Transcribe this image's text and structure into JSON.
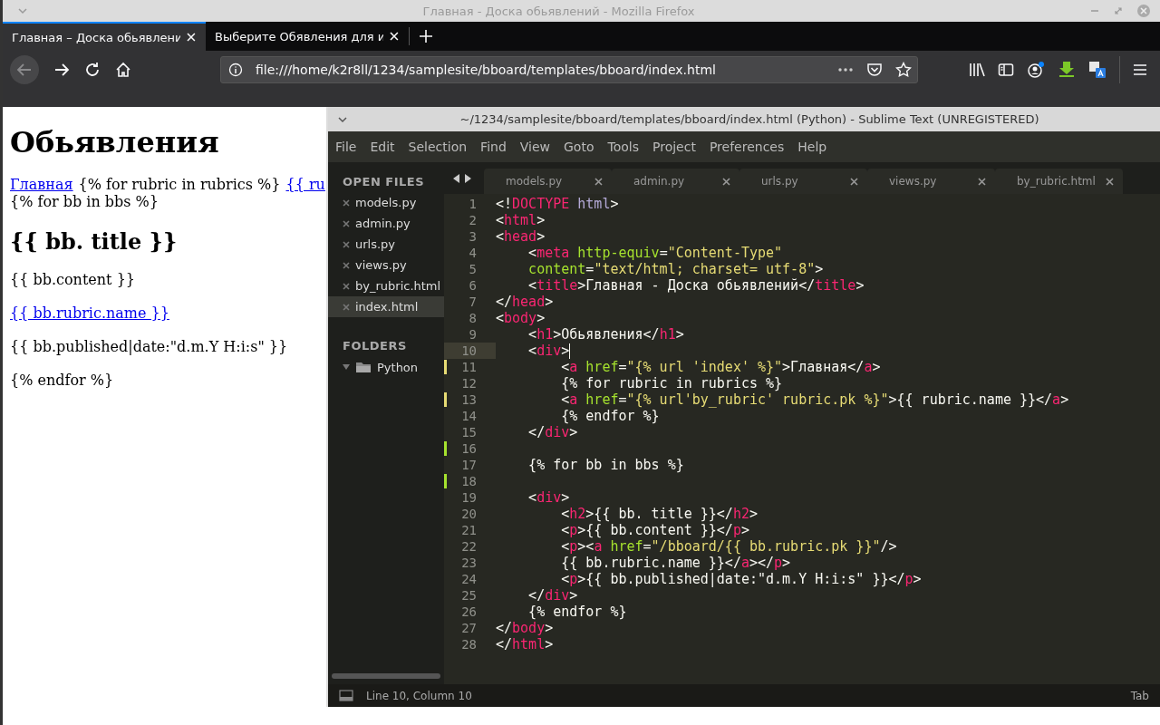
{
  "browser": {
    "title": "Главная - Доска обьявлений - Mozilla Firefox",
    "tabs": [
      {
        "label": "Главная – Доска обьявлени",
        "selected": true
      },
      {
        "label": "Выберите Обявления для и",
        "selected": false
      }
    ],
    "url": "file:///home/k2r8ll/1234/samplesite/bboard/templates/bboard/index.html",
    "page": {
      "heading": "Обьявления",
      "nav": [
        {
          "kind": "link",
          "text": "Главная"
        },
        {
          "kind": "text",
          "text": "{% for rubric in rubrics %}"
        },
        {
          "kind": "link",
          "text": "{{ ru"
        }
      ],
      "loop": "{% for bb in bbs %}",
      "title": "{{ bb. title }}",
      "blocks": [
        {
          "kind": "text",
          "text": "{{ bb.content }}"
        },
        {
          "kind": "link",
          "text": "{{ bb.rubric.name }}"
        },
        {
          "kind": "text",
          "text": "{{ bb.published|date:\"d.m.Y H:i:s\" }}"
        },
        {
          "kind": "text",
          "text": "{% endfor %}"
        }
      ]
    }
  },
  "editor": {
    "title": "~/1234/samplesite/bboard/templates/bboard/index.html (Python) - Sublime Text (UNREGISTERED)",
    "menu": [
      "File",
      "Edit",
      "Selection",
      "Find",
      "View",
      "Goto",
      "Tools",
      "Project",
      "Preferences",
      "Help"
    ],
    "open_files": {
      "heading": "OPEN FILES",
      "items": [
        {
          "name": "models.py",
          "selected": false
        },
        {
          "name": "admin.py",
          "selected": false
        },
        {
          "name": "urls.py",
          "selected": false
        },
        {
          "name": "views.py",
          "selected": false
        },
        {
          "name": "by_rubric.html",
          "selected": false
        },
        {
          "name": "index.html",
          "selected": true
        }
      ]
    },
    "folders": {
      "heading": "FOLDERS",
      "items": [
        {
          "name": "Python",
          "expanded": true
        }
      ]
    },
    "tabs": [
      {
        "label": "models.py",
        "selected": false
      },
      {
        "label": "admin.py",
        "selected": false
      },
      {
        "label": "urls.py",
        "selected": false
      },
      {
        "label": "views.py",
        "selected": false
      },
      {
        "label": "by_rubric.html",
        "selected": false
      }
    ],
    "lines": [
      {
        "number": "1",
        "current": false,
        "tokens": [
          {
            "kind": "p",
            "text": "<!"
          },
          {
            "kind": "tag",
            "text": "DOCTYPE"
          },
          {
            "kind": "kw",
            "text": " html"
          },
          {
            "kind": "p",
            "text": ">"
          }
        ]
      },
      {
        "number": "2",
        "current": false,
        "tokens": [
          {
            "kind": "p",
            "text": "<"
          },
          {
            "kind": "tag",
            "text": "html"
          },
          {
            "kind": "p",
            "text": ">"
          }
        ]
      },
      {
        "number": "3",
        "current": false,
        "tokens": [
          {
            "kind": "p",
            "text": "<"
          },
          {
            "kind": "tag",
            "text": "head"
          },
          {
            "kind": "p",
            "text": ">"
          }
        ]
      },
      {
        "number": "4",
        "current": false,
        "tokens": [
          {
            "kind": "p",
            "text": "    <"
          },
          {
            "kind": "tag",
            "text": "meta"
          },
          {
            "kind": "attr",
            "text": " http-equiv"
          },
          {
            "kind": "p",
            "text": "="
          },
          {
            "kind": "str",
            "text": "\"Content-Type\""
          }
        ]
      },
      {
        "number": "5",
        "current": false,
        "tokens": [
          {
            "kind": "attr",
            "text": "    content"
          },
          {
            "kind": "p",
            "text": "="
          },
          {
            "kind": "str",
            "text": "\"text/html; charset= utf-8\""
          },
          {
            "kind": "p",
            "text": ">"
          }
        ]
      },
      {
        "number": "6",
        "current": false,
        "tokens": [
          {
            "kind": "p",
            "text": "    <"
          },
          {
            "kind": "tag",
            "text": "title"
          },
          {
            "kind": "p",
            "text": ">Главная - Доска обьявлений</"
          },
          {
            "kind": "tag",
            "text": "title"
          },
          {
            "kind": "p",
            "text": ">"
          }
        ]
      },
      {
        "number": "7",
        "current": false,
        "tokens": [
          {
            "kind": "p",
            "text": "</"
          },
          {
            "kind": "tag",
            "text": "head"
          },
          {
            "kind": "p",
            "text": ">"
          }
        ]
      },
      {
        "number": "8",
        "current": false,
        "tokens": [
          {
            "kind": "p",
            "text": "<"
          },
          {
            "kind": "tag",
            "text": "body"
          },
          {
            "kind": "p",
            "text": ">"
          }
        ]
      },
      {
        "number": "9",
        "current": false,
        "tokens": [
          {
            "kind": "p",
            "text": "    <"
          },
          {
            "kind": "tag",
            "text": "h1"
          },
          {
            "kind": "p",
            "text": ">Обьявления</"
          },
          {
            "kind": "tag",
            "text": "h1"
          },
          {
            "kind": "p",
            "text": ">"
          }
        ]
      },
      {
        "number": "10",
        "current": true,
        "tokens": [
          {
            "kind": "p",
            "text": "    <"
          },
          {
            "kind": "tag",
            "text": "div"
          },
          {
            "kind": "p",
            "text": ">"
          }
        ]
      },
      {
        "number": "11",
        "current": false,
        "color": "#e6db74",
        "tokens": [
          {
            "kind": "p",
            "text": "        <"
          },
          {
            "kind": "tag",
            "text": "a"
          },
          {
            "kind": "attr",
            "text": " href"
          },
          {
            "kind": "p",
            "text": "="
          },
          {
            "kind": "str",
            "text": "\"{% url 'index' %}\""
          },
          {
            "kind": "p",
            "text": ">Главная</"
          },
          {
            "kind": "tag",
            "text": "a"
          },
          {
            "kind": "p",
            "text": ">"
          }
        ]
      },
      {
        "number": "12",
        "current": false,
        "tokens": [
          {
            "kind": "p",
            "text": "        {% for rubric in rubrics %}"
          }
        ]
      },
      {
        "number": "13",
        "current": false,
        "color": "#e6db74",
        "tokens": [
          {
            "kind": "p",
            "text": "        <"
          },
          {
            "kind": "tag",
            "text": "a"
          },
          {
            "kind": "attr",
            "text": " href"
          },
          {
            "kind": "p",
            "text": "="
          },
          {
            "kind": "str",
            "text": "\"{% url'by_rubric' rubric.pk %}\""
          },
          {
            "kind": "p",
            "text": ">{{ rubric.name }}</"
          },
          {
            "kind": "tag",
            "text": "a"
          },
          {
            "kind": "p",
            "text": ">"
          }
        ]
      },
      {
        "number": "14",
        "current": false,
        "tokens": [
          {
            "kind": "p",
            "text": "        {% endfor %}"
          }
        ]
      },
      {
        "number": "15",
        "current": false,
        "tokens": [
          {
            "kind": "p",
            "text": "    </"
          },
          {
            "kind": "tag",
            "text": "div"
          },
          {
            "kind": "p",
            "text": ">"
          }
        ]
      },
      {
        "number": "16",
        "current": false,
        "color": "#a6e22e"
      },
      {
        "number": "17",
        "current": false,
        "tokens": [
          {
            "kind": "p",
            "text": "    {% for bb in bbs %}"
          }
        ]
      },
      {
        "number": "18",
        "current": false,
        "color": "#a6e22e"
      },
      {
        "number": "19",
        "current": false,
        "tokens": [
          {
            "kind": "p",
            "text": "    <"
          },
          {
            "kind": "tag",
            "text": "div"
          },
          {
            "kind": "p",
            "text": ">"
          }
        ]
      },
      {
        "number": "20",
        "current": false,
        "tokens": [
          {
            "kind": "p",
            "text": "        <"
          },
          {
            "kind": "tag",
            "text": "h2"
          },
          {
            "kind": "p",
            "text": ">{{ bb. title }}</"
          },
          {
            "kind": "tag",
            "text": "h2"
          },
          {
            "kind": "p",
            "text": ">"
          }
        ]
      },
      {
        "number": "21",
        "current": false,
        "tokens": [
          {
            "kind": "p",
            "text": "        <"
          },
          {
            "kind": "tag",
            "text": "p"
          },
          {
            "kind": "p",
            "text": ">{{ bb.content }}</"
          },
          {
            "kind": "tag",
            "text": "p"
          },
          {
            "kind": "p",
            "text": ">"
          }
        ]
      },
      {
        "number": "22",
        "current": false,
        "tokens": [
          {
            "kind": "p",
            "text": "        <"
          },
          {
            "kind": "tag",
            "text": "p"
          },
          {
            "kind": "p",
            "text": "><"
          },
          {
            "kind": "tag",
            "text": "a"
          },
          {
            "kind": "attr",
            "text": " href"
          },
          {
            "kind": "p",
            "text": "="
          },
          {
            "kind": "str",
            "text": "\"/bboard/{{ bb.rubric.pk }}\""
          },
          {
            "kind": "p",
            "text": "/>"
          }
        ]
      },
      {
        "number": "23",
        "current": false,
        "tokens": [
          {
            "kind": "p",
            "text": "        {{ bb.rubric.name }}</"
          },
          {
            "kind": "tag",
            "text": "a"
          },
          {
            "kind": "p",
            "text": "></"
          },
          {
            "kind": "tag",
            "text": "p"
          },
          {
            "kind": "p",
            "text": ">"
          }
        ]
      },
      {
        "number": "24",
        "current": false,
        "tokens": [
          {
            "kind": "p",
            "text": "        <"
          },
          {
            "kind": "tag",
            "text": "p"
          },
          {
            "kind": "p",
            "text": ">{{ bb.published|date:\"d.m.Y H:i:s\" }}</"
          },
          {
            "kind": "tag",
            "text": "p"
          },
          {
            "kind": "p",
            "text": ">"
          }
        ]
      },
      {
        "number": "25",
        "current": false,
        "tokens": [
          {
            "kind": "p",
            "text": "    </"
          },
          {
            "kind": "tag",
            "text": "div"
          },
          {
            "kind": "p",
            "text": ">"
          }
        ]
      },
      {
        "number": "26",
        "current": false,
        "tokens": [
          {
            "kind": "p",
            "text": "    {% endfor %}"
          }
        ]
      },
      {
        "number": "27",
        "current": false,
        "tokens": [
          {
            "kind": "p",
            "text": "</"
          },
          {
            "kind": "tag",
            "text": "body"
          },
          {
            "kind": "p",
            "text": ">"
          }
        ]
      },
      {
        "number": "28",
        "current": false,
        "tokens": [
          {
            "kind": "p",
            "text": "</"
          },
          {
            "kind": "tag",
            "text": "html"
          },
          {
            "kind": "p",
            "text": ">"
          }
        ]
      }
    ],
    "status": {
      "position": "Line 10, Column 10",
      "indent": "Tab"
    }
  }
}
